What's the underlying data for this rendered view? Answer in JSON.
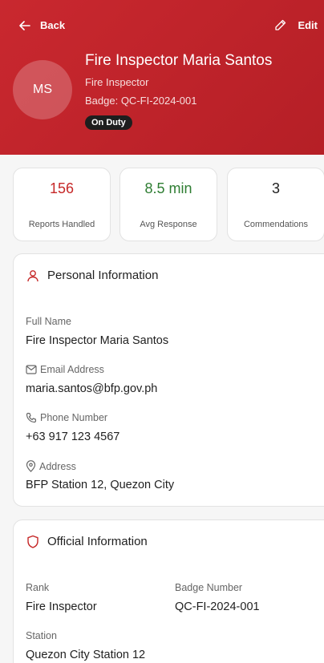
{
  "header": {
    "back_label": "Back",
    "edit_label": "Edit",
    "initials": "MS",
    "name": "Fire Inspector Maria Santos",
    "role": "Fire Inspector",
    "badge": "Badge: QC-FI-2024-001",
    "status": "On Duty"
  },
  "stats": [
    {
      "value": "156",
      "label": "Reports Handled",
      "color": "#c62828"
    },
    {
      "value": "8.5 min",
      "label": "Avg Response",
      "color": "#2e7d32"
    },
    {
      "value": "3",
      "label": "Commendations",
      "color": "#1f1f1f"
    }
  ],
  "personal": {
    "title": "Personal Information",
    "full_name_label": "Full Name",
    "full_name": "Fire Inspector Maria Santos",
    "email_label": "Email Address",
    "email": "maria.santos@bfp.gov.ph",
    "phone_label": "Phone Number",
    "phone": "+63 917 123 4567",
    "address_label": "Address",
    "address": "BFP Station 12, Quezon City"
  },
  "official": {
    "title": "Official Information",
    "rank_label": "Rank",
    "rank": "Fire Inspector",
    "badge_label": "Badge Number",
    "badge": "QC-FI-2024-001",
    "station_label": "Station",
    "station": "Quezon City Station 12"
  },
  "colors": {
    "accent": "#c62828",
    "header": "#c9282f"
  }
}
